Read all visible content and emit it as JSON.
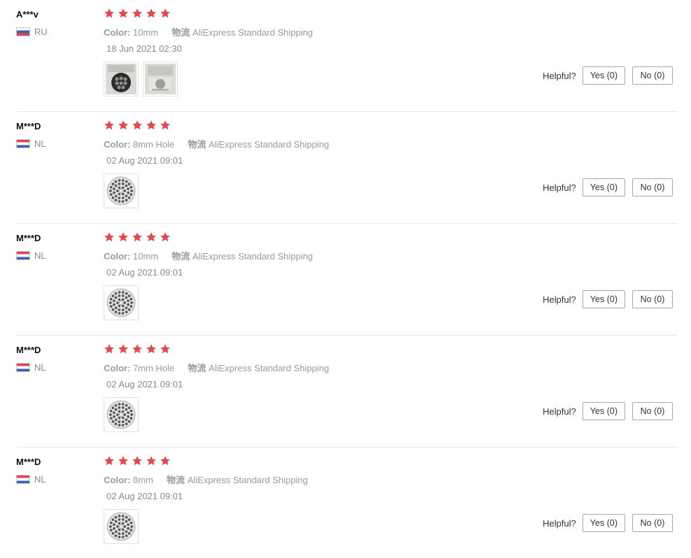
{
  "colors": {
    "star": "#e34b4b",
    "flag_red": "#d84b4b",
    "flag_blue": "#3a62b4"
  },
  "labels": {
    "color_label": "Color:",
    "shipping_label": "物流",
    "helpful": "Helpful?"
  },
  "reviews": [
    {
      "user": "A***v",
      "country": "RU",
      "flag": "ru-flag-icon",
      "rating": 5,
      "color": "10mm",
      "shipping": "AliExpress Standard Shipping",
      "date": "18 Jun 2021 02:30",
      "photos": [
        "photo-grinder-plate-dark",
        "photo-grinder-plate-packaged"
      ],
      "yes": "Yes (0)",
      "no": "No (0)"
    },
    {
      "user": "M***D",
      "country": "NL",
      "flag": "nl-flag-icon",
      "rating": 5,
      "color": "8mm Hole",
      "shipping": "AliExpress Standard Shipping",
      "date": "02 Aug 2021 09:01",
      "photos": [
        "photo-grinder-plate"
      ],
      "yes": "Yes (0)",
      "no": "No (0)"
    },
    {
      "user": "M***D",
      "country": "NL",
      "flag": "nl-flag-icon",
      "rating": 5,
      "color": "10mm",
      "shipping": "AliExpress Standard Shipping",
      "date": "02 Aug 2021 09:01",
      "photos": [
        "photo-grinder-plate"
      ],
      "yes": "Yes (0)",
      "no": "No (0)"
    },
    {
      "user": "M***D",
      "country": "NL",
      "flag": "nl-flag-icon",
      "rating": 5,
      "color": "7mm Hole",
      "shipping": "AliExpress Standard Shipping",
      "date": "02 Aug 2021 09:01",
      "photos": [
        "photo-grinder-plate"
      ],
      "yes": "Yes (0)",
      "no": "No (0)"
    },
    {
      "user": "M***D",
      "country": "NL",
      "flag": "nl-flag-icon",
      "rating": 5,
      "color": "8mm",
      "shipping": "AliExpress Standard Shipping",
      "date": "02 Aug 2021 09:01",
      "photos": [
        "photo-grinder-plate"
      ],
      "yes": "Yes (0)",
      "no": "No (0)"
    }
  ]
}
